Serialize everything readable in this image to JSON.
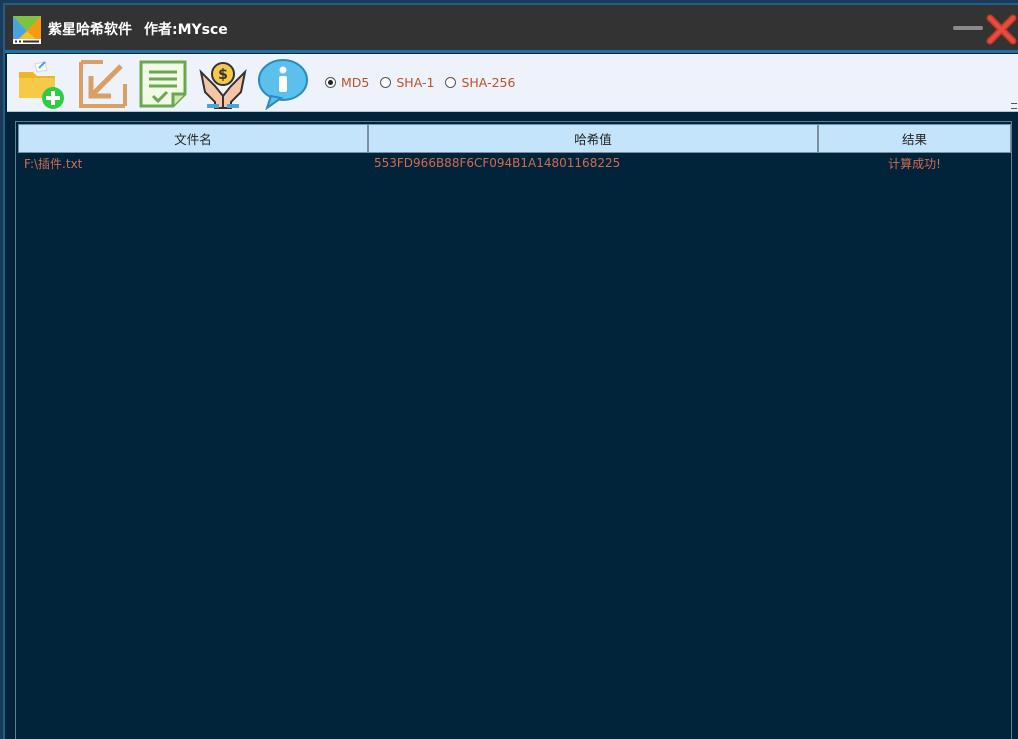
{
  "window": {
    "title": "紫星哈希软件",
    "author": "作者:MYsce"
  },
  "toolbar": {
    "buttons": [
      {
        "name": "add-file-button",
        "icon": "folder-add-icon"
      },
      {
        "name": "export-button",
        "icon": "arrow-down-left-icon"
      },
      {
        "name": "report-button",
        "icon": "document-check-icon"
      },
      {
        "name": "donate-button",
        "icon": "hands-coin-icon"
      },
      {
        "name": "about-button",
        "icon": "info-bubble-icon"
      }
    ],
    "algorithms": [
      {
        "label": "MD5",
        "checked": true
      },
      {
        "label": "SHA-1",
        "checked": false
      },
      {
        "label": "SHA-256",
        "checked": false
      }
    ]
  },
  "table": {
    "columns": [
      "文件名",
      "哈希值",
      "结果"
    ],
    "rows": [
      {
        "file": "F:\\插件.txt",
        "hash": "553FD966B88F6CF094B1A14801168225",
        "result": "计算成功!"
      }
    ]
  },
  "colors": {
    "titlebar": "#333333",
    "accent": "#1f6fa8",
    "toolbar": "#eef3fb",
    "list_bg": "#02243a",
    "header_bg": "#c3e4fb",
    "text_accent": "#d06a52"
  }
}
